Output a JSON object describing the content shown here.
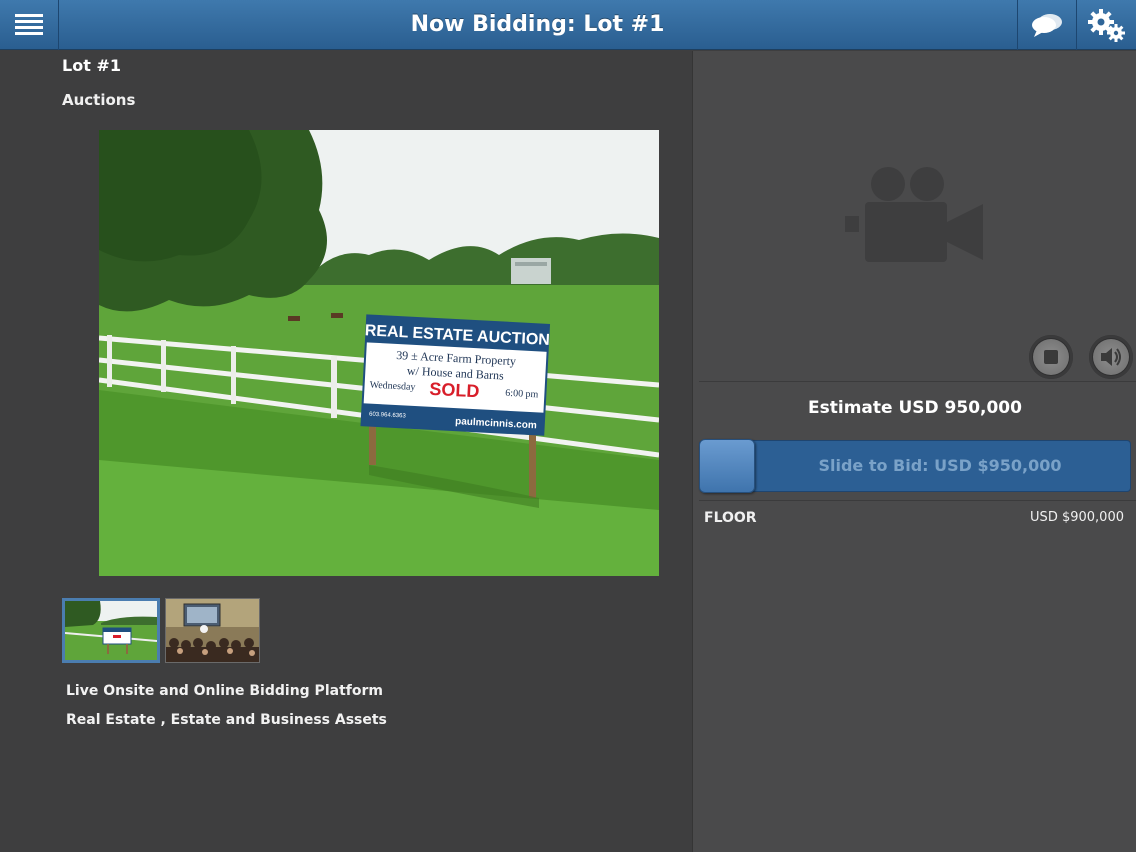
{
  "header": {
    "title": "Now Bidding: Lot #1",
    "menu_icon": "hamburger-menu-icon",
    "chat_icon": "chat-bubbles-icon",
    "settings_icon": "gears-icon",
    "color": "#2f6598"
  },
  "lot": {
    "title": "Lot #1",
    "category": "Auctions",
    "photo_sign": {
      "heading": "REAL ESTATE AUCTION",
      "line1": "39 ± Acre Farm Property",
      "line2": "w/ House and Barns",
      "line3_left": "Wednesday",
      "line3_right": "6:00 pm",
      "sold": "SOLD",
      "phone": "603.964.6363",
      "website": "paulmcinnis.com"
    },
    "thumbnails": [
      {
        "name": "farm-sign-photo",
        "selected": true
      },
      {
        "name": "auction-room-photo",
        "selected": false
      }
    ],
    "description_line1": "Live Onsite and Online Bidding Platform",
    "description_line2": "Real Estate , Estate and Business Assets"
  },
  "bidding": {
    "video_placeholder_icon": "video-camera-icon",
    "stop_icon": "stop-icon",
    "sound_icon": "speaker-icon",
    "estimate": "Estimate USD 950,000",
    "slider_label": "Slide to Bid: USD $950,000",
    "floor_label": "FLOOR",
    "floor_value": "USD $900,000",
    "accent": "#2c5f94"
  }
}
